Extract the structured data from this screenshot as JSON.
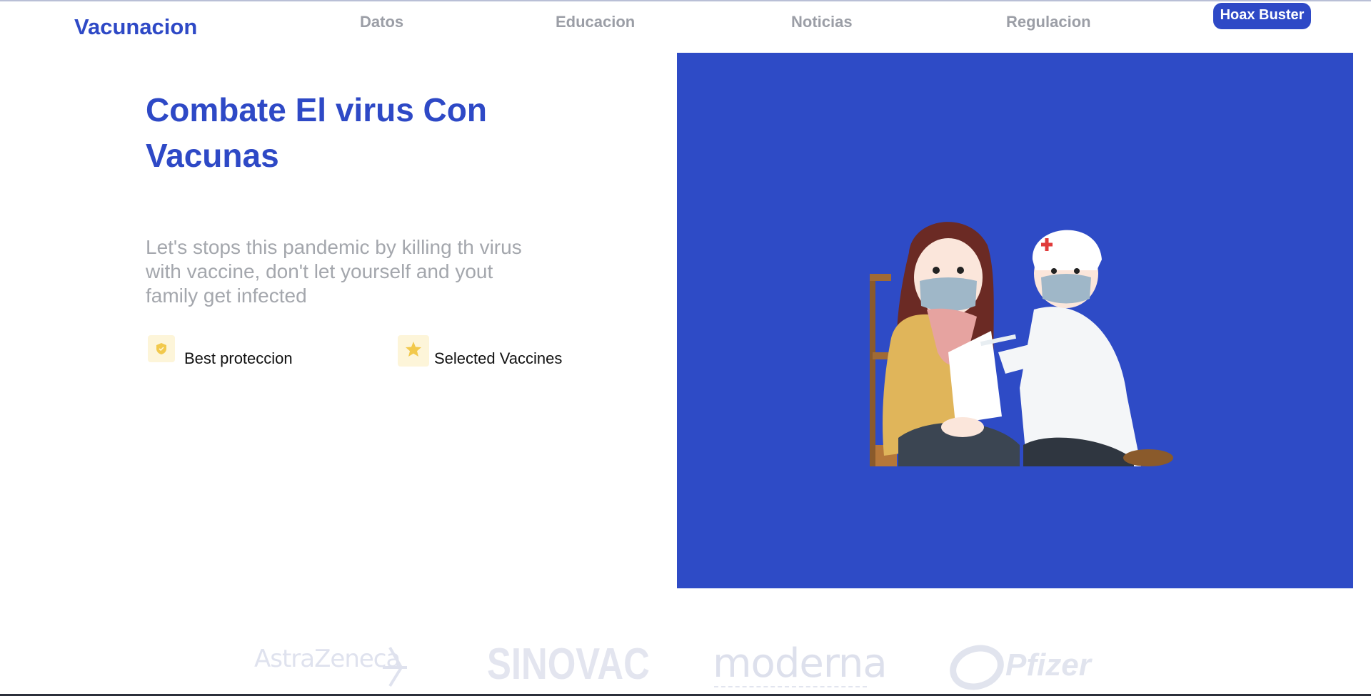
{
  "nav": {
    "brand": "Vacunacion",
    "links": [
      "Datos",
      "Educacion",
      "Noticias",
      "Regulacion"
    ],
    "cta": "Hoax Buster"
  },
  "hero": {
    "title_line1": "Combate El virus Con",
    "title_line2": "Vacunas",
    "description_line1": "Let's stops this pandemic by killing th virus",
    "description_line2": "with vaccine, don't let yourself and yout",
    "description_line3": "family get infected",
    "features": [
      {
        "icon": "shield-icon",
        "label": "Best proteccion"
      },
      {
        "icon": "star-icon",
        "label": "Selected Vaccines"
      }
    ],
    "image_background": "#2e4bc6"
  },
  "partners": [
    "AstraZeneca",
    "SINOVAC",
    "moderna",
    "Pfizer"
  ],
  "colors": {
    "brand": "#2e49c6",
    "muted_text": "#a4a7ad",
    "badge_bg": "#fdf5d9",
    "icon_yellow": "#f2c94c"
  }
}
